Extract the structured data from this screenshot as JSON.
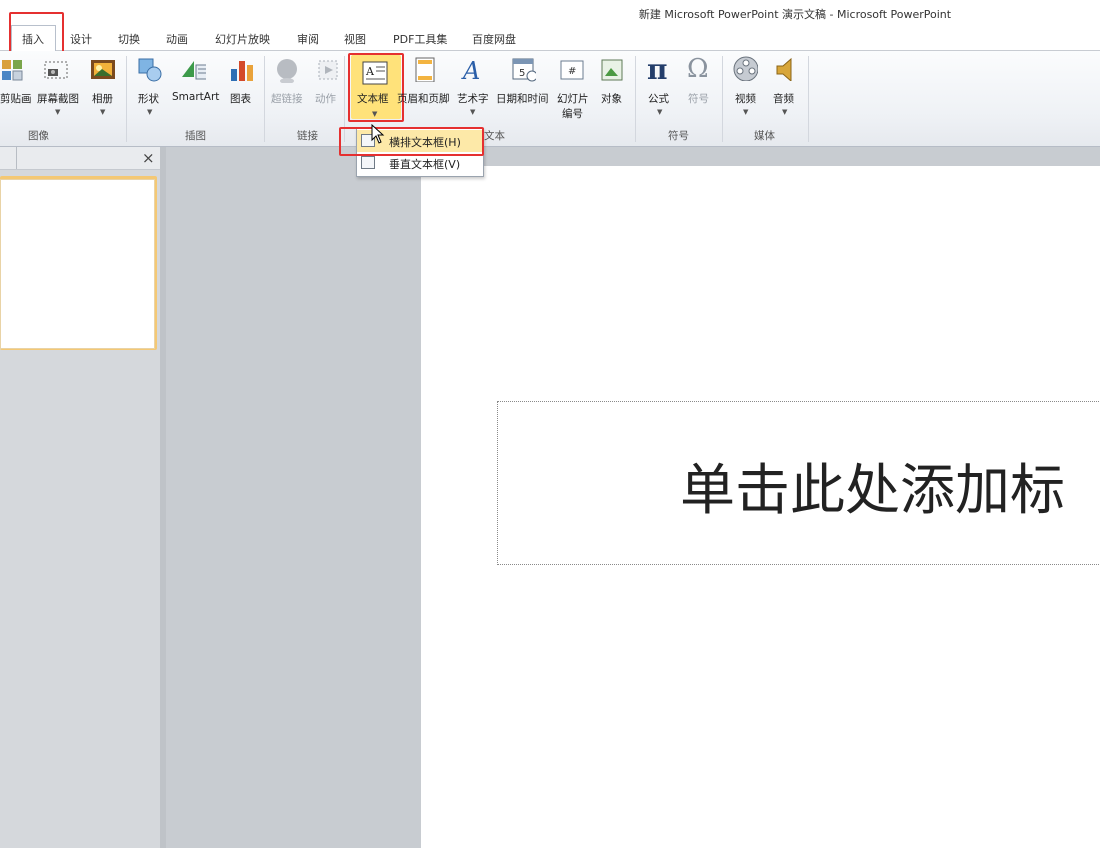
{
  "window": {
    "title": "新建 Microsoft PowerPoint 演示文稿 - Microsoft PowerPoint"
  },
  "tabs": [
    {
      "label": "插入",
      "active": true
    },
    {
      "label": "设计"
    },
    {
      "label": "切换"
    },
    {
      "label": "动画"
    },
    {
      "label": "幻灯片放映"
    },
    {
      "label": "审阅"
    },
    {
      "label": "视图"
    },
    {
      "label": "PDF工具集"
    },
    {
      "label": "百度网盘"
    }
  ],
  "ribbon": {
    "groups": {
      "image": "图像",
      "illustrations": "插图",
      "links": "链接",
      "text": "文本",
      "symbols": "符号",
      "media": "媒体"
    },
    "buttons": {
      "clipart": "剪贴画",
      "screenshot": "屏幕截图",
      "album": "相册",
      "shapes": "形状",
      "smartart": "SmartArt",
      "chart": "图表",
      "hyperlink": "超链接",
      "action": "动作",
      "textbox": "文本框",
      "header_footer": "页眉和页脚",
      "wordart": "艺术字",
      "datetime": "日期和时间",
      "slide_number_1": "幻灯片",
      "slide_number_2": "编号",
      "object": "对象",
      "equation": "公式",
      "symbol": "符号",
      "video": "视频",
      "audio": "音频"
    }
  },
  "textbox_menu": {
    "items": [
      {
        "label": "横排文本框(H)"
      },
      {
        "label": "垂直文本框(V)"
      }
    ]
  },
  "panel": {
    "close_glyph": "×"
  },
  "slide": {
    "title_placeholder": "单击此处添加标"
  },
  "colors": {
    "highlight_red": "#e53030",
    "button_highlight": "#ffe27a",
    "thumb_selected": "#f4c874"
  },
  "icons": [
    "clipart-icon",
    "screenshot-icon",
    "album-icon",
    "shapes-icon",
    "smartart-icon",
    "chart-icon",
    "hyperlink-icon",
    "action-icon",
    "textbox-icon",
    "header-footer-icon",
    "wordart-icon",
    "datetime-icon",
    "slide-number-icon",
    "object-icon",
    "equation-icon",
    "symbol-icon",
    "video-icon",
    "audio-icon",
    "horizontal-textbox-icon",
    "vertical-textbox-icon",
    "close-icon",
    "pointer-cursor-icon"
  ]
}
